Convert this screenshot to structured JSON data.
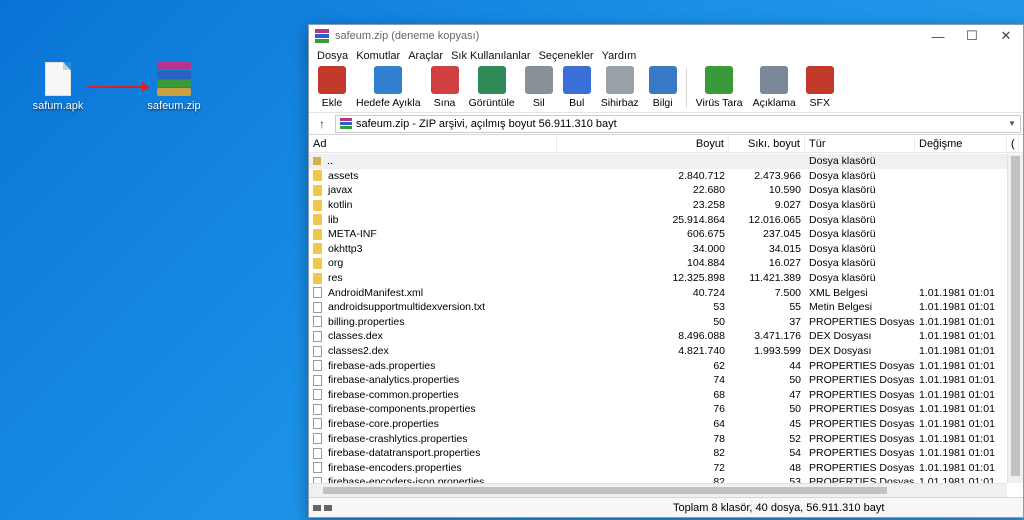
{
  "desktop": {
    "apk_label": "safum.apk",
    "zip_label": "safeum.zip"
  },
  "window": {
    "title": "safeum.zip (deneme kopyası)",
    "minimize": "—",
    "maximize": "☐",
    "close": "✕"
  },
  "menu": [
    "Dosya",
    "Komutlar",
    "Araçlar",
    "Sık Kullanılanlar",
    "Seçenekler",
    "Yardım"
  ],
  "toolbar": [
    {
      "label": "Ekle",
      "icon": "add-archive-icon",
      "color": "#c0392b"
    },
    {
      "label": "Hedefe Ayıkla",
      "icon": "extract-folder-icon",
      "color": "#2f80d0"
    },
    {
      "label": "Sına",
      "icon": "test-checklist-icon",
      "color": "#d04040"
    },
    {
      "label": "Görüntüle",
      "icon": "view-book-icon",
      "color": "#2e8b57"
    },
    {
      "label": "Sil",
      "icon": "trash-icon",
      "color": "#8a9099"
    },
    {
      "label": "Bul",
      "icon": "magnifier-icon",
      "color": "#3b6fd8"
    },
    {
      "label": "Sihirbaz",
      "icon": "wizard-wand-icon",
      "color": "#9aa0a8"
    },
    {
      "label": "Bilgi",
      "icon": "info-icon",
      "color": "#3a78c8"
    },
    {
      "label": "Virüs Tara",
      "icon": "virus-scan-icon",
      "color": "#3a9a3a"
    },
    {
      "label": "Açıklama",
      "icon": "comment-icon",
      "color": "#7a8899"
    },
    {
      "label": "SFX",
      "icon": "sfx-archive-icon",
      "color": "#c0392b"
    }
  ],
  "address": {
    "text": "safeum.zip - ZIP arşivi, açılmış boyut 56.911.310 bayt"
  },
  "columns": {
    "name": "Ad",
    "size": "Boyut",
    "packed": "Sıkı. boyut",
    "type": "Tür",
    "modified": "Değişme",
    "more": "("
  },
  "rows": [
    {
      "name": "..",
      "size": "",
      "packed": "",
      "type": "Dosya klasörü",
      "modified": "",
      "kind": "up"
    },
    {
      "name": "assets",
      "size": "2.840.712",
      "packed": "2.473.966",
      "type": "Dosya klasörü",
      "modified": "",
      "kind": "folder"
    },
    {
      "name": "javax",
      "size": "22.680",
      "packed": "10.590",
      "type": "Dosya klasörü",
      "modified": "",
      "kind": "folder"
    },
    {
      "name": "kotlin",
      "size": "23.258",
      "packed": "9.027",
      "type": "Dosya klasörü",
      "modified": "",
      "kind": "folder"
    },
    {
      "name": "lib",
      "size": "25.914.864",
      "packed": "12.016.065",
      "type": "Dosya klasörü",
      "modified": "",
      "kind": "folder"
    },
    {
      "name": "META-INF",
      "size": "606.675",
      "packed": "237.045",
      "type": "Dosya klasörü",
      "modified": "",
      "kind": "folder"
    },
    {
      "name": "okhttp3",
      "size": "34.000",
      "packed": "34.015",
      "type": "Dosya klasörü",
      "modified": "",
      "kind": "folder"
    },
    {
      "name": "org",
      "size": "104.884",
      "packed": "16.027",
      "type": "Dosya klasörü",
      "modified": "",
      "kind": "folder"
    },
    {
      "name": "res",
      "size": "12.325.898",
      "packed": "11.421.389",
      "type": "Dosya klasörü",
      "modified": "",
      "kind": "folder"
    },
    {
      "name": "AndroidManifest.xml",
      "size": "40.724",
      "packed": "7.500",
      "type": "XML Belgesi",
      "modified": "1.01.1981 01:01",
      "kind": "file"
    },
    {
      "name": "androidsupportmultidexversion.txt",
      "size": "53",
      "packed": "55",
      "type": "Metin Belgesi",
      "modified": "1.01.1981 01:01",
      "kind": "file"
    },
    {
      "name": "billing.properties",
      "size": "50",
      "packed": "37",
      "type": "PROPERTIES Dosyası",
      "modified": "1.01.1981 01:01",
      "kind": "file"
    },
    {
      "name": "classes.dex",
      "size": "8.496.088",
      "packed": "3.471.176",
      "type": "DEX Dosyası",
      "modified": "1.01.1981 01:01",
      "kind": "file"
    },
    {
      "name": "classes2.dex",
      "size": "4.821.740",
      "packed": "1.993.599",
      "type": "DEX Dosyası",
      "modified": "1.01.1981 01:01",
      "kind": "file"
    },
    {
      "name": "firebase-ads.properties",
      "size": "62",
      "packed": "44",
      "type": "PROPERTIES Dosyası",
      "modified": "1.01.1981 01:01",
      "kind": "file"
    },
    {
      "name": "firebase-analytics.properties",
      "size": "74",
      "packed": "50",
      "type": "PROPERTIES Dosyası",
      "modified": "1.01.1981 01:01",
      "kind": "file"
    },
    {
      "name": "firebase-common.properties",
      "size": "68",
      "packed": "47",
      "type": "PROPERTIES Dosyası",
      "modified": "1.01.1981 01:01",
      "kind": "file"
    },
    {
      "name": "firebase-components.properties",
      "size": "76",
      "packed": "50",
      "type": "PROPERTIES Dosyası",
      "modified": "1.01.1981 01:01",
      "kind": "file"
    },
    {
      "name": "firebase-core.properties",
      "size": "64",
      "packed": "45",
      "type": "PROPERTIES Dosyası",
      "modified": "1.01.1981 01:01",
      "kind": "file"
    },
    {
      "name": "firebase-crashlytics.properties",
      "size": "78",
      "packed": "52",
      "type": "PROPERTIES Dosyası",
      "modified": "1.01.1981 01:01",
      "kind": "file"
    },
    {
      "name": "firebase-datatransport.properties",
      "size": "82",
      "packed": "54",
      "type": "PROPERTIES Dosyası",
      "modified": "1.01.1981 01:01",
      "kind": "file"
    },
    {
      "name": "firebase-encoders.properties",
      "size": "72",
      "packed": "48",
      "type": "PROPERTIES Dosyası",
      "modified": "1.01.1981 01:01",
      "kind": "file"
    },
    {
      "name": "firebase-encoders-json.properties",
      "size": "82",
      "packed": "53",
      "type": "PROPERTIES Dosyası",
      "modified": "1.01.1981 01:01",
      "kind": "file"
    }
  ],
  "status": {
    "text": "Toplam 8 klasör, 40 dosya, 56.911.310 bayt"
  }
}
